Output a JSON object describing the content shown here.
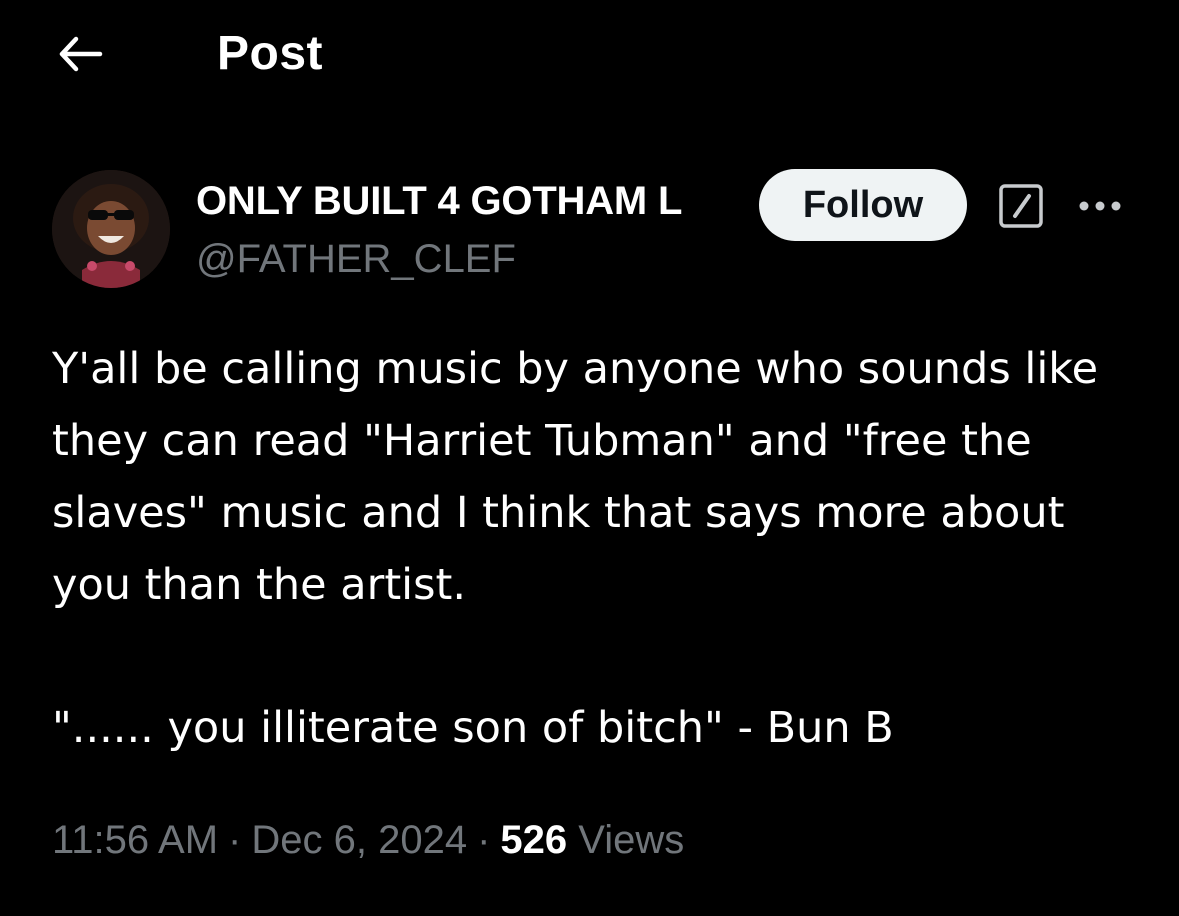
{
  "header": {
    "back_icon": "arrow-left-icon",
    "title": "Post"
  },
  "author": {
    "display_name": "ONLY BUILT 4 GOTHAM L",
    "handle": "@FATHER_CLEF",
    "follow_label": "Follow",
    "grok_icon": "grok-icon",
    "more_icon": "more-horizontal-icon"
  },
  "tweet": {
    "text": "Y'all be calling music by anyone who sounds like they can read \"Harriet Tubman\" and \"free the slaves\" music and I think that says more about you than the artist.",
    "quote": "\"...... you illiterate son of bitch\" - Bun B"
  },
  "meta": {
    "time": "11:56 AM",
    "separator": "·",
    "date": "Dec 6, 2024",
    "views_count": "526",
    "views_label": "Views"
  },
  "colors": {
    "background": "#000000",
    "primary_text": "#e7e9ea",
    "secondary_text": "#71767b",
    "follow_bg": "#eff3f4",
    "follow_text": "#0f1419"
  }
}
